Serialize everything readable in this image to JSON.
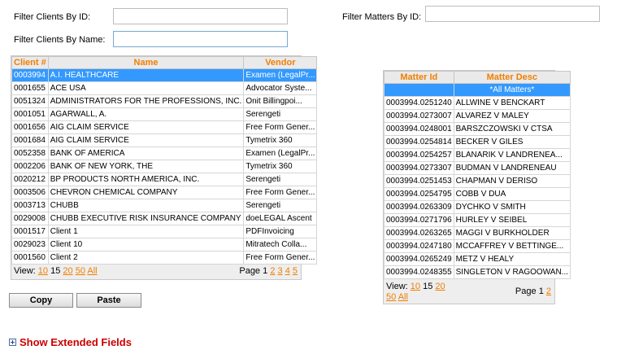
{
  "filters": {
    "client_id_label": "Filter Clients By ID:",
    "client_name_label": "Filter Clients By Name:",
    "matter_id_label": "Filter Matters By ID:",
    "client_id_value": "",
    "client_name_value": "",
    "matter_id_value": ""
  },
  "clients": {
    "headers": [
      "Client #",
      "Name",
      "Vendor"
    ],
    "rows": [
      [
        "0003994",
        "A.I. HEALTHCARE",
        "Examen (LegalPr..."
      ],
      [
        "0001655",
        "ACE USA",
        "Advocator Syste..."
      ],
      [
        "0051324",
        "ADMINISTRATORS FOR THE PROFESSIONS, INC.",
        "Onit Billingpoi..."
      ],
      [
        "0001051",
        "AGARWALL, A.",
        "Serengeti"
      ],
      [
        "0001656",
        "AIG CLAIM SERVICE",
        "Free Form Gener..."
      ],
      [
        "0001684",
        "AIG CLAIM SERVICE",
        "Tymetrix 360"
      ],
      [
        "0052358",
        "BANK OF AMERICA",
        "Examen (LegalPr..."
      ],
      [
        "0002206",
        "BANK OF NEW YORK, THE",
        "Tymetrix 360"
      ],
      [
        "0020212",
        "BP PRODUCTS NORTH AMERICA, INC.",
        "Serengeti"
      ],
      [
        "0003506",
        "CHEVRON CHEMICAL COMPANY",
        "Free Form Gener..."
      ],
      [
        "0003713",
        "CHUBB",
        "Serengeti"
      ],
      [
        "0029008",
        "CHUBB EXECUTIVE RISK INSURANCE COMPANY",
        "doeLEGAL Ascent"
      ],
      [
        "0001517",
        "Client 1",
        "PDFInvoicing"
      ],
      [
        "0029023",
        "Client 10",
        "Mitratech Colla..."
      ],
      [
        "0001560",
        "Client 2",
        "Free Form Gener..."
      ]
    ],
    "selected_row": 0,
    "pager": {
      "view_label": "View:",
      "sizes": [
        "10",
        "15",
        "20",
        "50",
        "All"
      ],
      "current_size": "15",
      "page_label": "Page",
      "pages": [
        "1",
        "2",
        "3",
        "4",
        "5"
      ],
      "current_page": "1"
    }
  },
  "matters": {
    "headers": [
      "Matter Id",
      "Matter Desc"
    ],
    "rows": [
      [
        "",
        "*All Matters*"
      ],
      [
        "0003994.0251240",
        "ALLWINE V BENCKART"
      ],
      [
        "0003994.0273007",
        "ALVAREZ V MALEY"
      ],
      [
        "0003994.0248001",
        "BARSZCZOWSKI V CTSA"
      ],
      [
        "0003994.0254814",
        "BECKER V GILES"
      ],
      [
        "0003994.0254257",
        "BLANARIK V LANDRENEA..."
      ],
      [
        "0003994.0273307",
        "BUDMAN V LANDRENEAU"
      ],
      [
        "0003994.0251453",
        "CHAPMAN V DERISO"
      ],
      [
        "0003994.0254795",
        "COBB V DUA"
      ],
      [
        "0003994.0263309",
        "DYCHKO V SMITH"
      ],
      [
        "0003994.0271796",
        "HURLEY V SEIBEL"
      ],
      [
        "0003994.0263265",
        "MAGGI V BURKHOLDER"
      ],
      [
        "0003994.0247180",
        "MCCAFFREY V BETTINGE..."
      ],
      [
        "0003994.0265249",
        "METZ V HEALY"
      ],
      [
        "0003994.0248355",
        "SINGLETON V RAGOOWAN..."
      ]
    ],
    "selected_row": 0,
    "pager": {
      "view_label": "View:",
      "sizes": [
        "10",
        "15",
        "20",
        "50",
        "All"
      ],
      "current_size": "15",
      "page_label": "Page",
      "pages": [
        "1",
        "2"
      ],
      "current_page": "1"
    }
  },
  "buttons": {
    "copy": "Copy",
    "paste": "Paste"
  },
  "extended": {
    "label": "Show Extended Fields",
    "icon": "plus-box-icon"
  },
  "colors": {
    "header_text": "#f07f00",
    "selection": "#3399ff",
    "extended_link": "#cc0000"
  }
}
